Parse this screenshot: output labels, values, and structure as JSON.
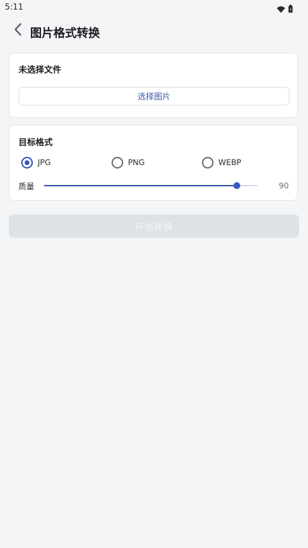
{
  "status_bar": {
    "time": "5:11",
    "icons": [
      "wifi-icon",
      "battery-icon"
    ]
  },
  "app_bar": {
    "back_icon": "chevron-left-icon",
    "title": "图片格式转换"
  },
  "file_card": {
    "status_text": "未选择文件",
    "select_button_label": "选择图片"
  },
  "format_card": {
    "heading": "目标格式",
    "options": [
      {
        "label": "JPG",
        "selected": true
      },
      {
        "label": "PNG",
        "selected": false
      },
      {
        "label": "WEBP",
        "selected": false
      }
    ],
    "quality_label": "质量",
    "quality_value": "90",
    "quality_min": 0,
    "quality_max": 100
  },
  "actions": {
    "start_label": "开始转换",
    "start_enabled": false
  },
  "colors": {
    "accent": "#3a56b8",
    "background": "#f4f5f7",
    "card": "#ffffff",
    "disabled_button": "#dde2e6"
  }
}
